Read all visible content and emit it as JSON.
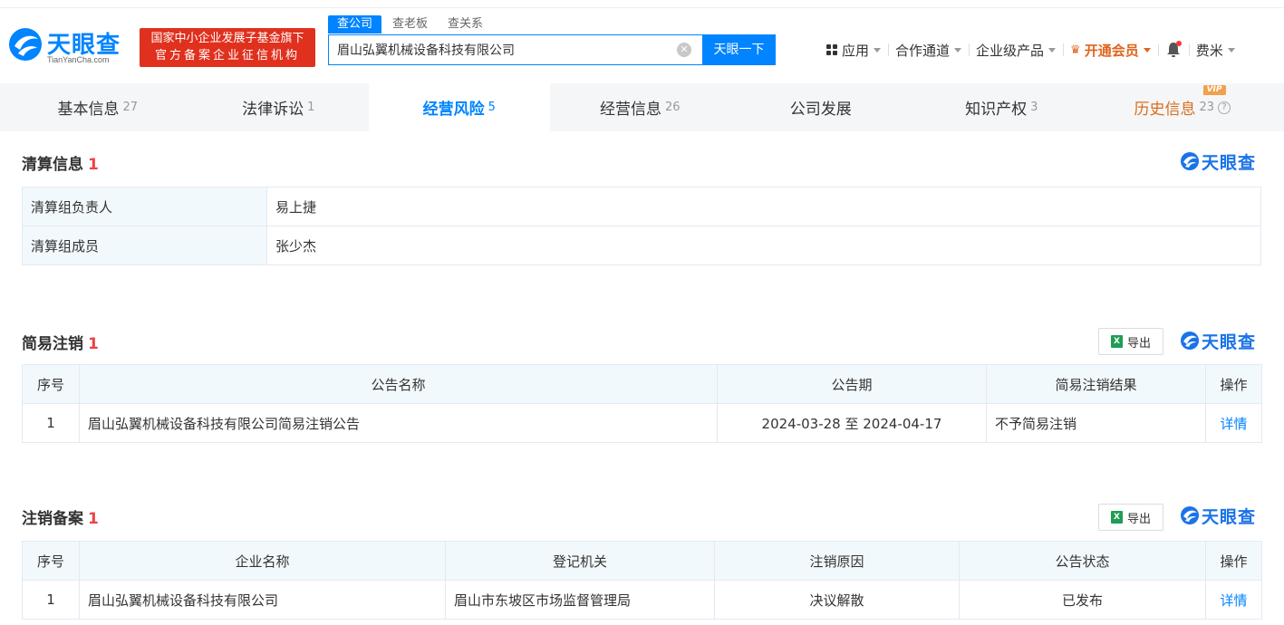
{
  "header": {
    "logo_text": "天眼查",
    "logo_sub": "TianYanCha.com",
    "gov_badge_line1": "国家中小企业发展子基金旗下",
    "gov_badge_line2": "官方备案企业征信机构",
    "search_tabs": [
      "查公司",
      "查老板",
      "查关系"
    ],
    "search_value": "眉山弘翼机械设备科技有限公司",
    "search_button": "天眼一下",
    "nav": {
      "apps": "应用",
      "channels": "合作通道",
      "enterprise": "企业级产品",
      "vip": "开通会员",
      "user": "费米"
    }
  },
  "tabs": [
    {
      "label": "基本信息",
      "count": "27"
    },
    {
      "label": "法律诉讼",
      "count": "1"
    },
    {
      "label": "经营风险",
      "count": "5"
    },
    {
      "label": "经营信息",
      "count": "26"
    },
    {
      "label": "公司发展",
      "count": ""
    },
    {
      "label": "知识产权",
      "count": "3"
    },
    {
      "label": "历史信息",
      "count": "23",
      "badge": "VIP"
    }
  ],
  "brand": "天眼查",
  "liquidation": {
    "title": "清算信息",
    "count": "1",
    "rows": [
      {
        "key": "清算组负责人",
        "value": "易上捷"
      },
      {
        "key": "清算组成员",
        "value": "张少杰"
      }
    ]
  },
  "simple_cancel": {
    "title": "简易注销",
    "count": "1",
    "export": "导出",
    "columns": [
      "序号",
      "公告名称",
      "公告期",
      "简易注销结果",
      "操作"
    ],
    "rows": [
      {
        "no": "1",
        "name": "眉山弘翼机械设备科技有限公司简易注销公告",
        "period": "2024-03-28 至 2024-04-17",
        "result": "不予简易注销",
        "action": "详情"
      }
    ]
  },
  "cancel_record": {
    "title": "注销备案",
    "count": "1",
    "export": "导出",
    "columns": [
      "序号",
      "企业名称",
      "登记机关",
      "注销原因",
      "公告状态",
      "操作"
    ],
    "rows": [
      {
        "no": "1",
        "name": "眉山弘翼机械设备科技有限公司",
        "authority": "眉山市东坡区市场监督管理局",
        "reason": "决议解散",
        "status": "已发布",
        "action": "详情"
      }
    ]
  },
  "colors": {
    "accent": "#0084ff",
    "count_red": "#f04142",
    "vip_orange": "#d86e1c",
    "badge_red": "#e0301e"
  }
}
